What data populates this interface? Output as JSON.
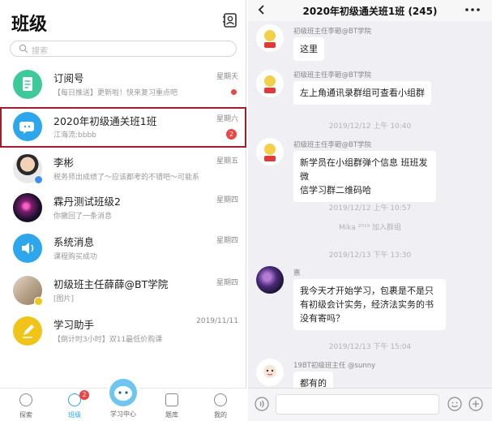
{
  "left": {
    "title": "班级",
    "search_placeholder": "搜索",
    "items": [
      {
        "name": "订阅号",
        "sub": "【每日推送】更新啦！快来复习重点吧",
        "time": "星期天",
        "unread": "dot"
      },
      {
        "name": "2020年初级通关班1班",
        "sub": "江海流:bbbb",
        "time": "星期六",
        "unread": "2"
      },
      {
        "name": "李彬",
        "sub": "税务师出成绩了～应该都考的不错吧～可能系…",
        "time": "星期五"
      },
      {
        "name": "霖丹测试班级2",
        "sub": "你撤回了一条消息",
        "time": "星期四"
      },
      {
        "name": "系统消息",
        "sub": "课程购买成功",
        "time": "星期四"
      },
      {
        "name": "初级班主任薛薛@BT学院",
        "sub": "[图片]",
        "time": "星期四"
      },
      {
        "name": "学习助手",
        "sub": "【倒计时3小时】双11最低价购课",
        "time": "2019/11/11"
      }
    ],
    "tabs": [
      {
        "label": "探索"
      },
      {
        "label": "班级",
        "badge": "2"
      },
      {
        "label": "学习中心"
      },
      {
        "label": "题库"
      },
      {
        "label": "我的"
      }
    ]
  },
  "chat": {
    "title": "2020年初级通关班1班 (245)",
    "messages": [
      {
        "sender": "初级班主任李砸@BT学院",
        "text": "这里"
      },
      {
        "sender": "初级班主任李砸@BT学院",
        "text": "左上角通讯录群组可查看小组群"
      },
      {
        "system": "2019/12/12 上午 10:40"
      },
      {
        "sender": "初级班主任李砸@BT学院",
        "lines": [
          "新学员在小组群弹个信息 班班发微",
          "信学习群二维码哈"
        ]
      },
      {
        "system": "2019/12/12 上午 10:57"
      },
      {
        "system": "Mika ²⁰¹⁹ 加入群组"
      },
      {
        "system": "2019/12/13 下午 13:30"
      },
      {
        "sender": "惠",
        "lines": [
          "我今天才开始学习，包裹是不是只",
          "有初级会计实务，经济法实务的书",
          "没有寄吗？"
        ]
      },
      {
        "system": "2019/12/13 下午 15:04"
      },
      {
        "sender": "19BT初级班主任 @sunny",
        "text": "都有的"
      }
    ]
  },
  "colors": {
    "accent": "#2ea6ec",
    "badge_red": "#ee4444",
    "selection_border": "#a01e2a",
    "chat_bg": "#efeff4"
  }
}
